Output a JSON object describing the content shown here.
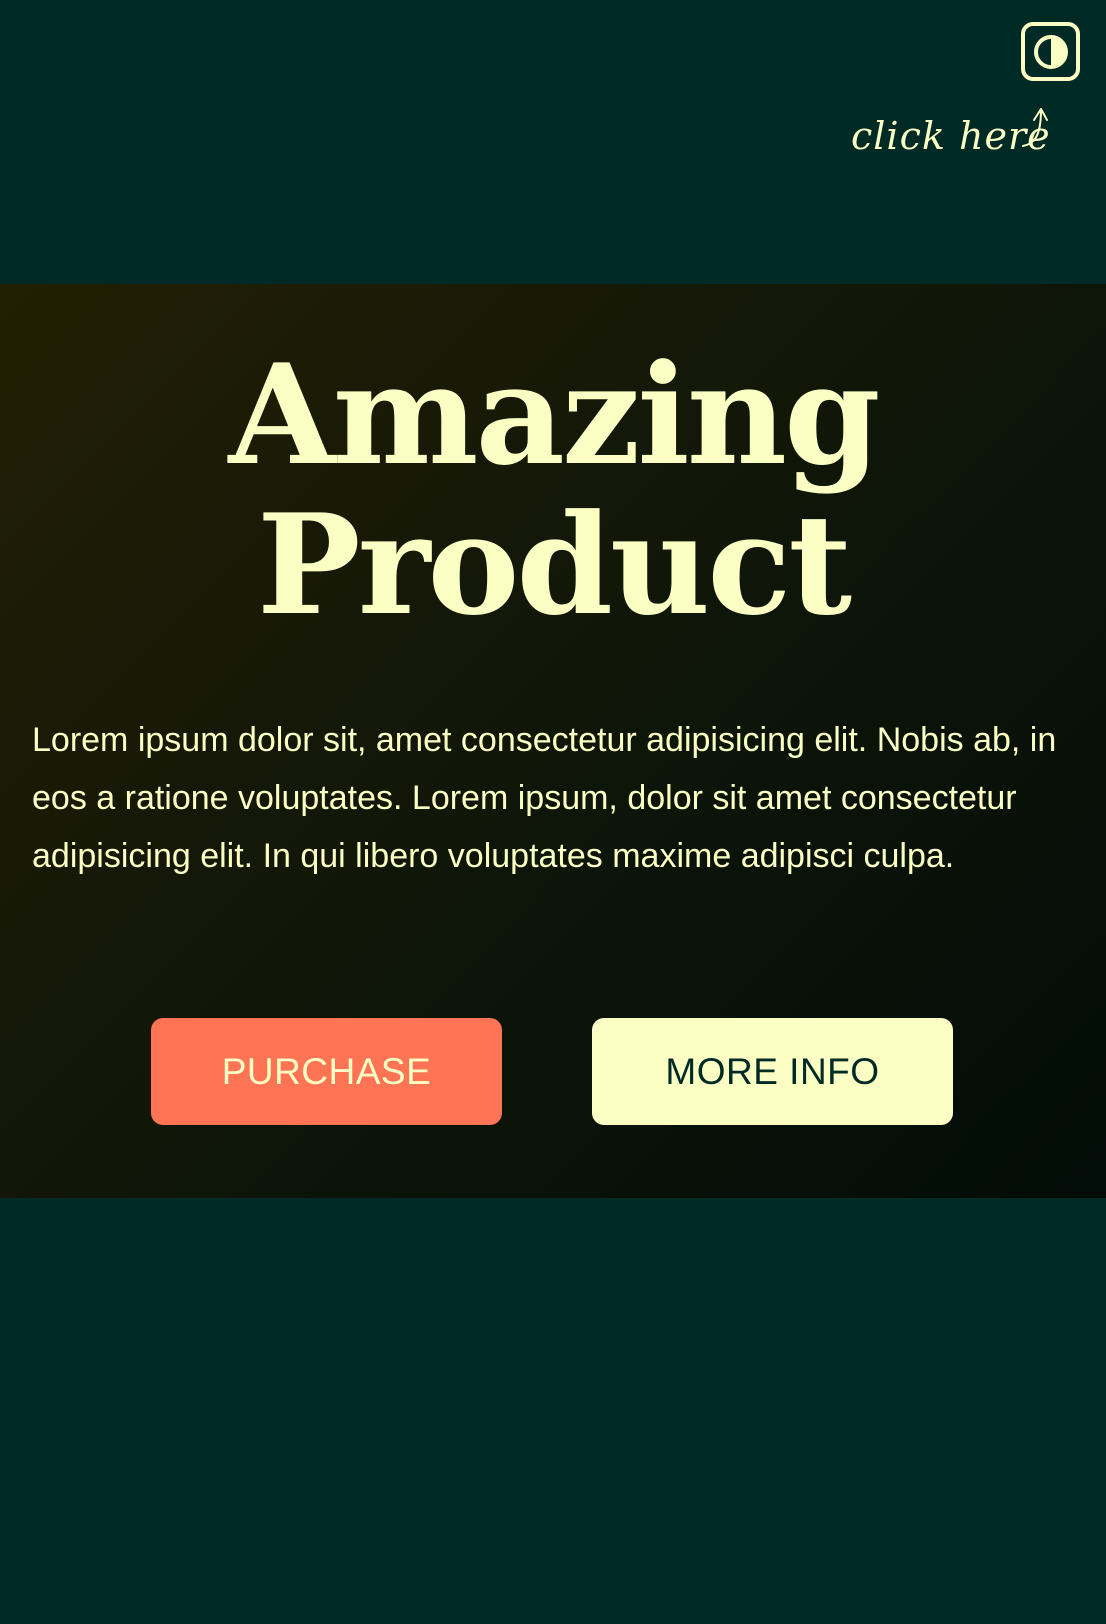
{
  "header": {
    "theme_toggle_icon": "contrast-icon",
    "hint_text": "click here",
    "hint_arrow_icon": "curved-arrow-up-icon"
  },
  "hero": {
    "title_line1": "Amazing",
    "title_line2": "Product",
    "description": "Lorem ipsum dolor sit, amet consectetur adipisicing elit. Nobis ab, in eos a ratione voluptates. Lorem ipsum, dolor sit amet consectetur adipisicing elit. In qui libero voluptates maxime adipisci culpa.",
    "purchase_label": "PURCHASE",
    "more_info_label": "MORE INFO"
  },
  "colors": {
    "background": "#002a26",
    "accent_cream": "#fcffc4",
    "accent_coral": "#ff7455"
  }
}
